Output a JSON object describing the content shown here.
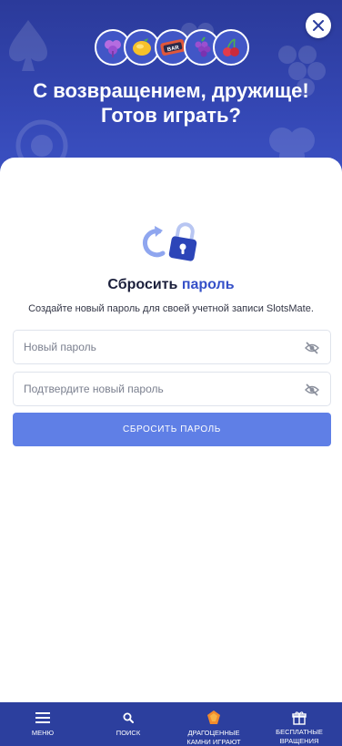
{
  "hero": {
    "title_line1": "С возвращением, дружище!",
    "title_line2": "Готов играть?",
    "symbols": [
      "clover-icon",
      "lemon-icon",
      "bar-icon",
      "grapes-icon",
      "cherry-icon"
    ],
    "bar_text": "BAR"
  },
  "close": {
    "icon": "close-icon"
  },
  "reset": {
    "title_prefix": "Сбросить",
    "title_accent": "пароль",
    "subtitle": "Создайте новый пароль для своей учетной записи SlotsMate.",
    "new_password_placeholder": "Новый пароль",
    "confirm_password_placeholder": "Подтвердите новый пароль",
    "submit_label": "СБРОСИТЬ ПАРОЛЬ"
  },
  "nav": {
    "menu": "МЕНЮ",
    "search": "ПОИСК",
    "gems_line1": "ДРАГОЦЕННЫЕ",
    "gems_line2": "КАМНИ ИГРАЮТ",
    "spins_line1": "БЕСПЛАТНЫЕ",
    "spins_line2": "ВРАЩЕНИЯ"
  },
  "colors": {
    "hero_bg": "#3447b4",
    "accent": "#3550c8",
    "button": "#5f7fe6",
    "nav_bg": "#2c3f9e"
  }
}
